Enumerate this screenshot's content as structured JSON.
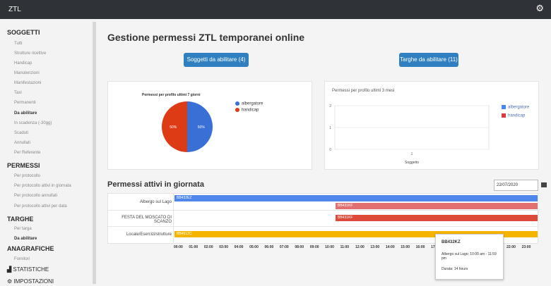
{
  "topbar": {
    "brand": "ZTL"
  },
  "sidebar": {
    "sections": [
      {
        "title": "SOGGETTI",
        "items": [
          "Tutti",
          "Strutture ricettive",
          "Handicap",
          "Manutenzioni",
          "Manifestazioni",
          "Taxi",
          "Permanenti",
          "Da abilitare",
          "In scadenza (-30gg)",
          "Scaduti",
          "Annullati",
          "Per Referente"
        ]
      },
      {
        "title": "PERMESSI",
        "items": [
          "Per protocollo",
          "Per protocollo attivi in giornata",
          "Per protocollo annullati",
          "Per protocollo attivi per data"
        ]
      },
      {
        "title": "TARGHE",
        "items": [
          "Per targa",
          "Da abilitare"
        ]
      },
      {
        "title": "ANAGRAFICHE",
        "items": [
          "Fornitori"
        ]
      }
    ],
    "statistiche": "STATISTICHE",
    "impostazioni": "IMPOSTAZIONI"
  },
  "main": {
    "title": "Gestione permessi ZTL temporanei online",
    "btn_soggetti": "Soggetti da abilitare (4)",
    "btn_targhe": "Targhe da abilitare (11)",
    "section_title": "Permessi attivi in giornata",
    "date_value": "22/07/2020"
  },
  "chart_data": [
    {
      "type": "pie",
      "title": "Permessi per profilo ultimi 7 giorni",
      "categories": [
        "albergatore",
        "handicap"
      ],
      "values": [
        50,
        50
      ],
      "labels": [
        "50%",
        "50%"
      ],
      "colors": [
        "#3a6fd6",
        "#dd3b16"
      ],
      "legend": "top-right"
    },
    {
      "type": "bar",
      "title": "Permessi per profilo ultimi 3 mesi",
      "categories": [
        "Soggetto"
      ],
      "x_tick_labels": [
        "1"
      ],
      "xlabel": "Soggetto",
      "y_ticks": [
        "0",
        "1",
        "2"
      ],
      "series": [
        {
          "name": "albergatore",
          "values": [
            0
          ],
          "color": "#4f86ec"
        },
        {
          "name": "handicap",
          "values": [
            0
          ],
          "color": "#dd3b3b"
        }
      ],
      "legend": "right"
    }
  ],
  "timeline": {
    "rows": [
      "Albergo sul Lago",
      "FESTA DEL MOSCATO DI SCANZO",
      "Locale/Esercizi/strutture"
    ],
    "bars": [
      {
        "label": "BB432EZ",
        "color": "#4f86ec",
        "row": 0
      },
      {
        "label": "BB431KF",
        "color": "#e37070",
        "row": 0
      },
      {
        "label": "BB431KF",
        "color": "#dd4a3a",
        "row": 1
      },
      {
        "label": "BB451ZC",
        "color": "#f4b400",
        "row": 2
      }
    ],
    "hours": [
      "00:00",
      "01:00",
      "02:00",
      "03:00",
      "04:00",
      "05:00",
      "06:00",
      "07:00",
      "08:00",
      "09:00",
      "10:00",
      "11:00",
      "12:00",
      "13:00",
      "14:00",
      "15:00",
      "16:00",
      "17:00",
      "18:00",
      "19:00",
      "20:00",
      "21:00",
      "22:00",
      "23:00"
    ]
  },
  "tooltip": {
    "plate": "BB432KZ",
    "desc": "Albergo sul Lago: 10:00 am - 11:59 pm",
    "duration": "Durata: 14 hours"
  }
}
